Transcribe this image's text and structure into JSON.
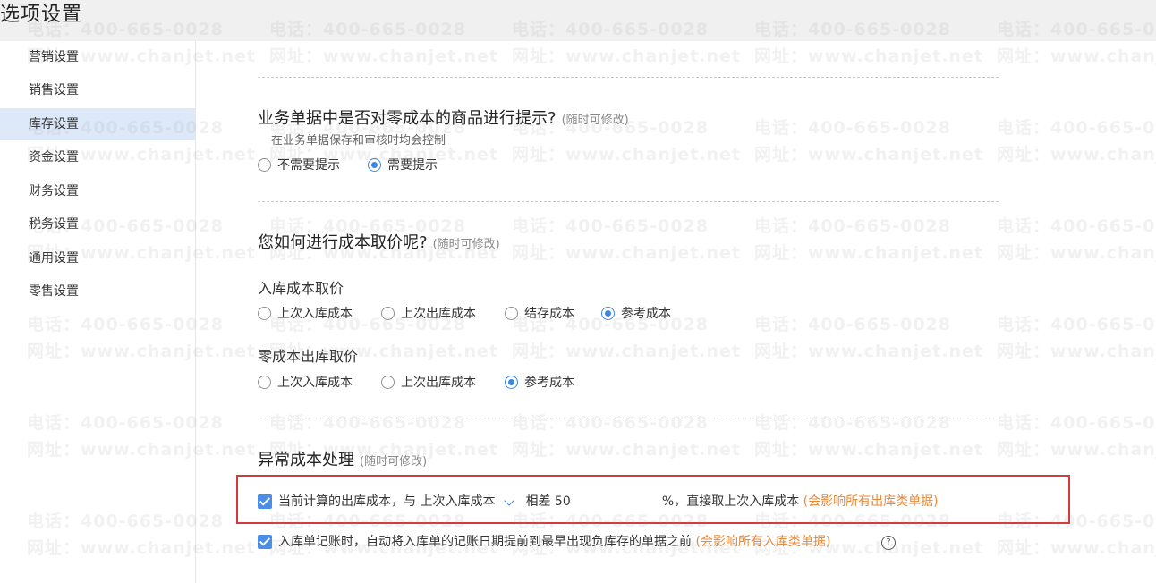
{
  "title": "选项设置",
  "sidebar": {
    "items": [
      {
        "label": "营销设置"
      },
      {
        "label": "销售设置"
      },
      {
        "label": "库存设置",
        "active": true
      },
      {
        "label": "资金设置"
      },
      {
        "label": "财务设置"
      },
      {
        "label": "税务设置"
      },
      {
        "label": "通用设置"
      },
      {
        "label": "零售设置"
      }
    ]
  },
  "watermark": {
    "line1": "电话：400-665-0028",
    "line2": "网址：www.chanjet.net"
  },
  "section_zero_cost": {
    "heading": "业务单据中是否对零成本的商品进行提示?",
    "note": "(随时可修改)",
    "sub": "在业务单据保存和审核时均会控制",
    "options": [
      "不需要提示",
      "需要提示"
    ],
    "selected": "需要提示"
  },
  "section_cost_price": {
    "heading": "您如何进行成本取价呢?",
    "note": "(随时可修改)",
    "inbound_label": "入库成本取价",
    "inbound_options": [
      "上次入库成本",
      "上次出库成本",
      "结存成本",
      "参考成本"
    ],
    "inbound_selected": "参考成本",
    "zero_out_label": "零成本出库取价",
    "zero_out_options": [
      "上次入库成本",
      "上次出库成本",
      "参考成本"
    ],
    "zero_out_selected": "参考成本"
  },
  "section_abnormal": {
    "heading": "异常成本处理",
    "note": "(随时可修改)",
    "rule1": {
      "checked": true,
      "prefix": "当前计算的出库成本，与",
      "compare_select": "上次入库成本",
      "diff_label": "相差",
      "diff_value": "50",
      "suffix": "%，直接取上次入库成本",
      "warning": "(会影响所有出库类单据)"
    },
    "rule2": {
      "checked": true,
      "text": "入库单记账时，自动将入库单的记账日期提前到最早出现负库存的单据之前",
      "warning": "(会影响所有入库类单据)",
      "help_icon": "?"
    }
  }
}
